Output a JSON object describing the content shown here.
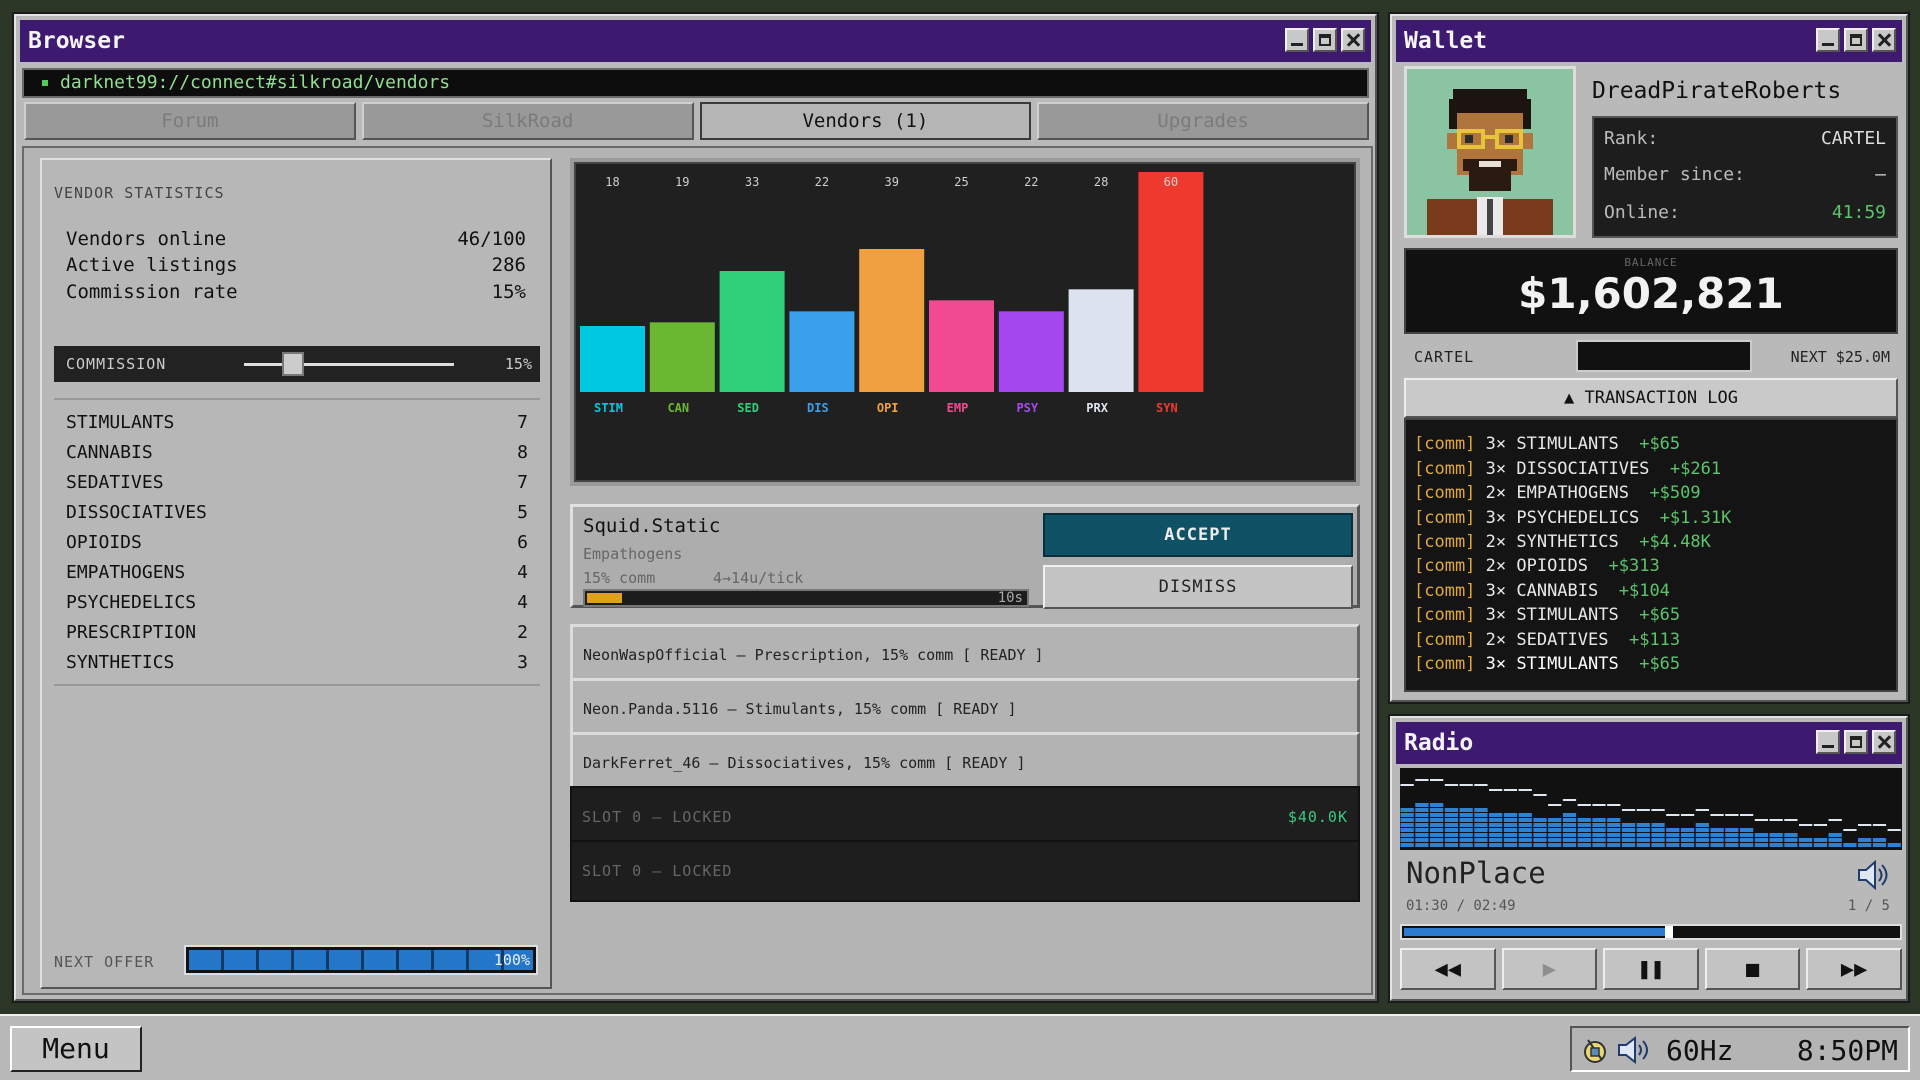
{
  "browser": {
    "title": "Browser",
    "url": "darknet99://connect#silkroad/vendors",
    "tabs": [
      "Forum",
      "SilkRoad",
      "Vendors (1)",
      "Upgrades"
    ],
    "stats": {
      "header": "VENDOR STATISTICS",
      "rows": [
        {
          "label": "Vendors online",
          "value": "46/100"
        },
        {
          "label": "Active listings",
          "value": "286"
        },
        {
          "label": "Commission rate",
          "value": "15%"
        }
      ],
      "commission_label": "COMMISSION",
      "commission_value": "15%",
      "commission_level": 0.25,
      "categories": [
        {
          "label": "STIMULANTS",
          "value": "7"
        },
        {
          "label": "CANNABIS",
          "value": "8"
        },
        {
          "label": "SEDATIVES",
          "value": "7"
        },
        {
          "label": "DISSOCIATIVES",
          "value": "5"
        },
        {
          "label": "OPIOIDS",
          "value": "6"
        },
        {
          "label": "EMPATHOGENS",
          "value": "4"
        },
        {
          "label": "PSYCHEDELICS",
          "value": "4"
        },
        {
          "label": "PRESCRIPTION",
          "value": "2"
        },
        {
          "label": "SYNTHETICS",
          "value": "3"
        }
      ],
      "next_offer_label": "NEXT OFFER",
      "next_offer_pct": "100%"
    },
    "offer": {
      "vendor": "Squid.Static",
      "category": "Empathogens",
      "comm": "15% comm",
      "rate": "4→14u/tick",
      "timer": "10s",
      "timer_fraction": 0.08,
      "accept_label": "ACCEPT",
      "dismiss_label": "DISMISS"
    },
    "queue": [
      "NeonWaspOfficial  —  Prescription, 15% comm  [ READY ]",
      "Neon.Panda.5116  —  Stimulants, 15% comm  [ READY ]",
      "DarkFerret_46  —  Dissociatives, 15% comm  [ READY ]"
    ],
    "slots": [
      {
        "label": "SLOT 0  —  LOCKED",
        "price": "$40.0K"
      },
      {
        "label": "SLOT 0  —  LOCKED",
        "price": ""
      }
    ]
  },
  "chart_data": {
    "type": "bar",
    "categories": [
      "STIM",
      "CAN",
      "SED",
      "DIS",
      "OPI",
      "EMP",
      "PSY",
      "PRX",
      "SYN"
    ],
    "values": [
      18,
      19,
      33,
      22,
      39,
      25,
      22,
      28,
      60
    ],
    "colors": [
      "#00c8e0",
      "#6ab832",
      "#2ed07a",
      "#3aa0ee",
      "#f0a040",
      "#f24a92",
      "#a648f0",
      "#dde3ee",
      "#ee3a2e"
    ],
    "ylim": [
      0,
      60
    ],
    "title": "",
    "xlabel": "",
    "ylabel": ""
  },
  "wallet": {
    "title": "Wallet",
    "username": "DreadPirateRoberts",
    "rank_label": "Rank:",
    "rank_value": "CARTEL",
    "member_label": "Member since:",
    "member_value": "—",
    "online_label": "Online:",
    "online_value": "41:59",
    "balance_label": "BALANCE",
    "balance": "$1,602,821",
    "progress_left": "CARTEL",
    "progress_right": "NEXT  $25.0M",
    "txlog_header": "▲  TRANSACTION LOG",
    "transactions": [
      {
        "tag": "[comm]",
        "what": " 3× STIMULANTS",
        "amt": "+$65"
      },
      {
        "tag": "[comm]",
        "what": " 3× DISSOCIATIVES",
        "amt": "+$261"
      },
      {
        "tag": "[comm]",
        "what": " 2× EMPATHOGENS",
        "amt": "+$509"
      },
      {
        "tag": "[comm]",
        "what": " 3× PSYCHEDELICS",
        "amt": "+$1.31K"
      },
      {
        "tag": "[comm]",
        "what": " 2× SYNTHETICS",
        "amt": "+$4.48K"
      },
      {
        "tag": "[comm]",
        "what": " 2× OPIOIDS",
        "amt": "+$313"
      },
      {
        "tag": "[comm]",
        "what": " 3× CANNABIS",
        "amt": "+$104"
      },
      {
        "tag": "[comm]",
        "what": " 3× STIMULANTS",
        "amt": "+$65"
      },
      {
        "tag": "[comm]",
        "what": " 2× SEDATIVES",
        "amt": "+$113"
      },
      {
        "tag": "[comm]",
        "what": " 3× STIMULANTS",
        "amt": "+$65"
      }
    ]
  },
  "radio": {
    "title": "Radio",
    "track": "NonPlace",
    "time": "01:30 / 02:49",
    "track_num": "1 / 5",
    "progress": 0.53
  },
  "taskbar": {
    "menu": "Menu",
    "refresh": "60Hz",
    "clock": "8:50PM"
  },
  "colors": {
    "titlebar": "#3d1a70",
    "accept": "#0f5266",
    "positive": "#5bc46b",
    "tag": "#e0a83a"
  },
  "icons": [
    "minimize-icon",
    "maximize-icon",
    "close-icon",
    "speaker-icon",
    "prev-icon",
    "play-icon",
    "pause-icon",
    "stop-icon",
    "next-icon",
    "network-icon"
  ]
}
